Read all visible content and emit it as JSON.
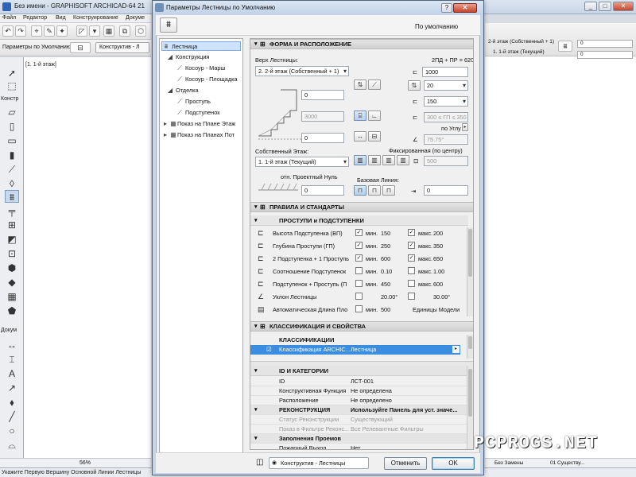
{
  "app": {
    "window_title": "Без имени - GRAPHISOFT ARCHICAD-64 21",
    "menu": [
      "Файл",
      "Редактор",
      "Вид",
      "Конструирование",
      "Докуме"
    ],
    "info_box_label": "Параметры по Умолчанию",
    "layer_combo": "Конструктив - Л",
    "story_tab": "[1. 1-й этаж]",
    "palette_sections": {
      "design": "Констр",
      "document": "Докум"
    },
    "zoom_value": "56%",
    "status_text": "Укажите Первую Вершину Основной Линии Лестницы",
    "side_labels": {
      "minimize": "_",
      "maximize": "□",
      "close": "✕"
    },
    "right_info": {
      "story_label_top": "2-й этаж (Собственный + 1)",
      "story_label_bottom": "1. 1-й этаж (Текущий)",
      "value_top": "0",
      "value_bottom": "0",
      "status_left": "Без Замены",
      "status_right": "01 Существу..."
    }
  },
  "dialog": {
    "title": "Параметры Лестницы по Умолчанию",
    "help": "?",
    "close": "✕",
    "preset_label": "По умолчанию",
    "tree": [
      {
        "label": "Лестница",
        "level": 0,
        "selected": true,
        "icon": "stair-icon"
      },
      {
        "label": "Конструкция",
        "level": 1,
        "selected": false,
        "icon": "structure-icon"
      },
      {
        "label": "Косоур - Марш",
        "level": 2,
        "selected": false,
        "icon": "stringer-icon"
      },
      {
        "label": "Косоур - Площадка",
        "level": 2,
        "selected": false,
        "icon": "stringer-icon"
      },
      {
        "label": "Отделка",
        "level": 1,
        "selected": false,
        "icon": "finish-icon"
      },
      {
        "label": "Проступь",
        "level": 2,
        "selected": false,
        "icon": "tread-icon"
      },
      {
        "label": "Подступенок",
        "level": 2,
        "selected": false,
        "icon": "riser-icon"
      },
      {
        "label": "Показ на Плане Этаж",
        "level": 0,
        "selected": false,
        "icon": "floorplan-icon"
      },
      {
        "label": "Показ на Планах Пот",
        "level": 0,
        "selected": false,
        "icon": "ceilingplan-icon"
      }
    ],
    "sections": {
      "geometry": "ФОРМА И РАСПОЛОЖЕНИЕ",
      "rules": "ПРАВИЛА И СТАНДАРТЫ",
      "treads_risers": "ПРОСТУПИ и ПОДСТУПЕНКИ",
      "classification": "КЛАССИФИКАЦИЯ И СВОЙСТВА",
      "classifications_sub": "КЛАССИФИКАЦИИ",
      "id_categories": "ID И КАТЕГОРИИ"
    },
    "geometry": {
      "top_label": "Верх Лестницы:",
      "top_value": "2. 2-й этаж (Собственный + 1)",
      "top_offset": "0",
      "height": "3000",
      "bottom_offset": "0",
      "home_story_label": "Собственный Этаж:",
      "home_story_value": "1. 1-й этаж (Текущий)",
      "ref_level_label": "отн. Проектный Нуль",
      "ref_level_value": "0",
      "formula": "2ПД + ПР = 620",
      "total_run": "1000",
      "riser_count": "20",
      "width": "150",
      "rule_value": "300 ≤ ГП ≤ 350",
      "by_angle": "по Углу",
      "angle": "75.75°",
      "fixed_label": "Фиксированная (по центру)",
      "fixed_value": "500",
      "baseline_label": "Базовая Линия:",
      "baseline_offset": "0"
    },
    "rules_rows": [
      {
        "name": "Высота Подступенка (ВП)",
        "min_checked": true,
        "min_label": "мин.",
        "min": "150",
        "max_checked": true,
        "max_label": "макс.",
        "max": "200"
      },
      {
        "name": "Глубина Проступи (ГП)",
        "min_checked": true,
        "min_label": "мин.",
        "min": "250",
        "max_checked": true,
        "max_label": "макс.",
        "max": "350"
      },
      {
        "name": "2 Подступенка + 1 Проступь",
        "min_checked": true,
        "min_label": "мин.",
        "min": "600",
        "max_checked": true,
        "max_label": "макс.",
        "max": "650"
      },
      {
        "name": "Соотношение Подступенок",
        "min_checked": false,
        "min_label": "мин.",
        "min": "0.10",
        "max_checked": false,
        "max_label": "макс.",
        "max": "1.00"
      },
      {
        "name": "Подступенок + Проступь (П",
        "min_checked": false,
        "min_label": "мин.",
        "min": "450",
        "max_checked": false,
        "max_label": "макс.",
        "max": "600"
      },
      {
        "name": "Уклон Лестницы",
        "min_checked": false,
        "min_label": "",
        "min": "20.00°",
        "max_checked": false,
        "max_label": "",
        "max": "30.00°"
      },
      {
        "name": "Автоматическая Длина Пло",
        "min_checked": false,
        "min_label": "мин.",
        "min": "500",
        "max_checked": null,
        "max_label": "",
        "max": "Единицы Модели"
      }
    ],
    "classification_row": {
      "name": "Классификация ARCHIC...",
      "value": "Лестница"
    },
    "id_rows": [
      {
        "key": "ID",
        "value": "ЛСТ-001",
        "dim": false,
        "header": false
      },
      {
        "key": "Конструктивная Функция",
        "value": "Не определена",
        "dim": false,
        "header": false
      },
      {
        "key": "Расположение",
        "value": "Не определено",
        "dim": false,
        "header": false
      },
      {
        "key": "РЕКОНСТРУКЦИЯ",
        "value": "Используйте Панель для уст. значе...",
        "dim": false,
        "header": true
      },
      {
        "key": "Статус Реконструкции",
        "value": "Существующий",
        "dim": true,
        "header": false
      },
      {
        "key": "Показ в Фильтре Реконс...",
        "value": "Все Релевантные Фильтры",
        "dim": true,
        "header": false
      },
      {
        "key": "Заполнения Проемов",
        "value": "",
        "dim": false,
        "header": true
      },
      {
        "key": "Пожарный Выход",
        "value": "Нет",
        "dim": false,
        "header": false
      }
    ],
    "footer": {
      "layer": "Конструктив - Лестницы",
      "cancel": "Отменить",
      "ok": "OK"
    }
  },
  "watermark": "PCPROGS.NET",
  "colors": {
    "title_bar": "#c9d6e6",
    "dialog_frame": "#c6d5e8",
    "selection": "#cfe2fb",
    "close_red": "#c5452d"
  }
}
